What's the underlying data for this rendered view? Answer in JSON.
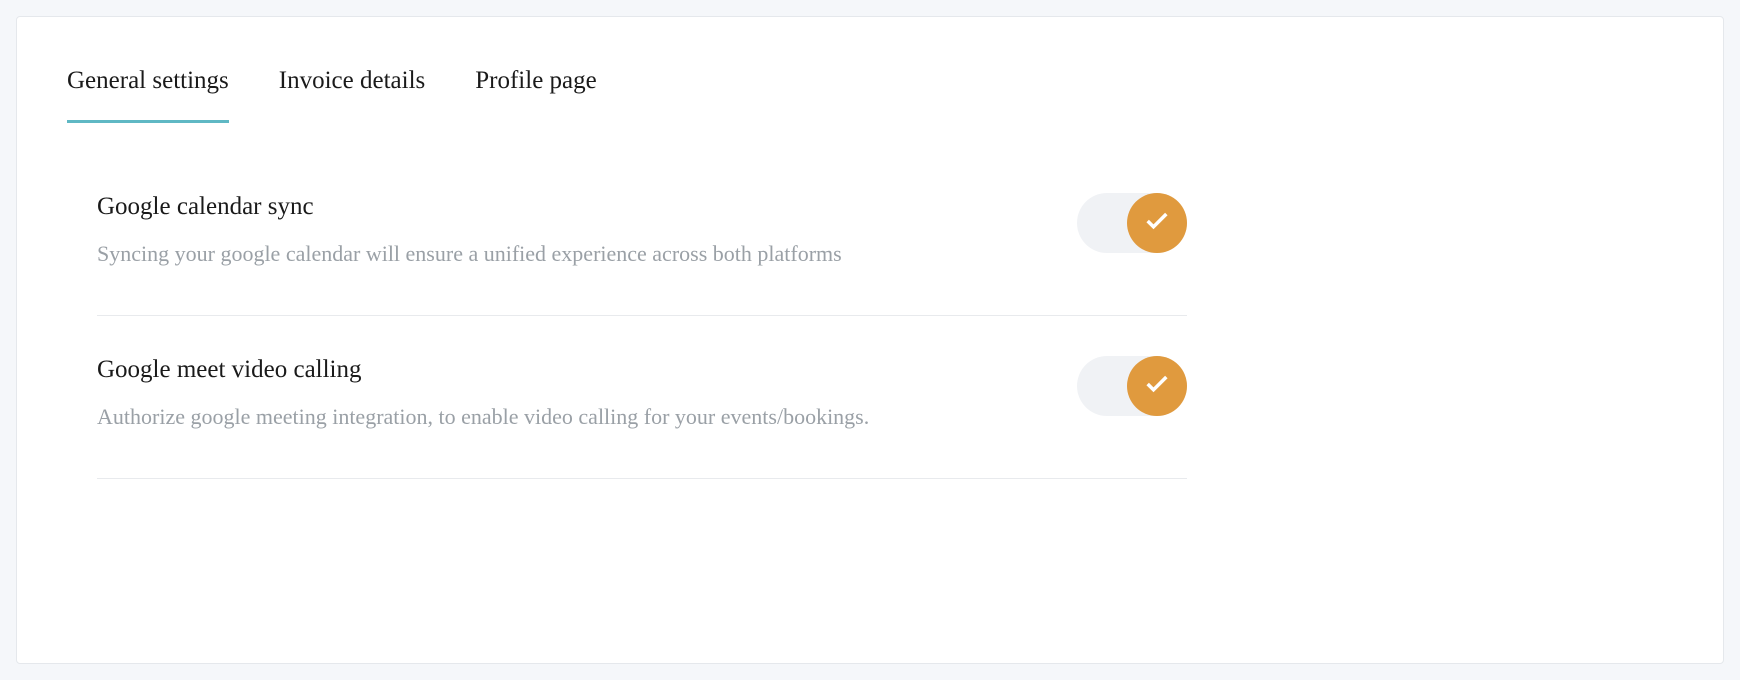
{
  "tabs": [
    {
      "label": "General settings",
      "active": true
    },
    {
      "label": "Invoice details",
      "active": false
    },
    {
      "label": "Profile page",
      "active": false
    }
  ],
  "settings": [
    {
      "title": "Google calendar sync",
      "description": "Syncing your google calendar will ensure a unified experience across both platforms",
      "enabled": true
    },
    {
      "title": "Google meet video calling",
      "description": "Authorize google meeting integration, to enable video calling for your events/bookings.",
      "enabled": true
    }
  ],
  "colors": {
    "accent_tab": "#5fb8c4",
    "toggle_on": "#e09a3e",
    "toggle_track": "#f0f2f5",
    "text_muted": "#9aa0a6"
  }
}
